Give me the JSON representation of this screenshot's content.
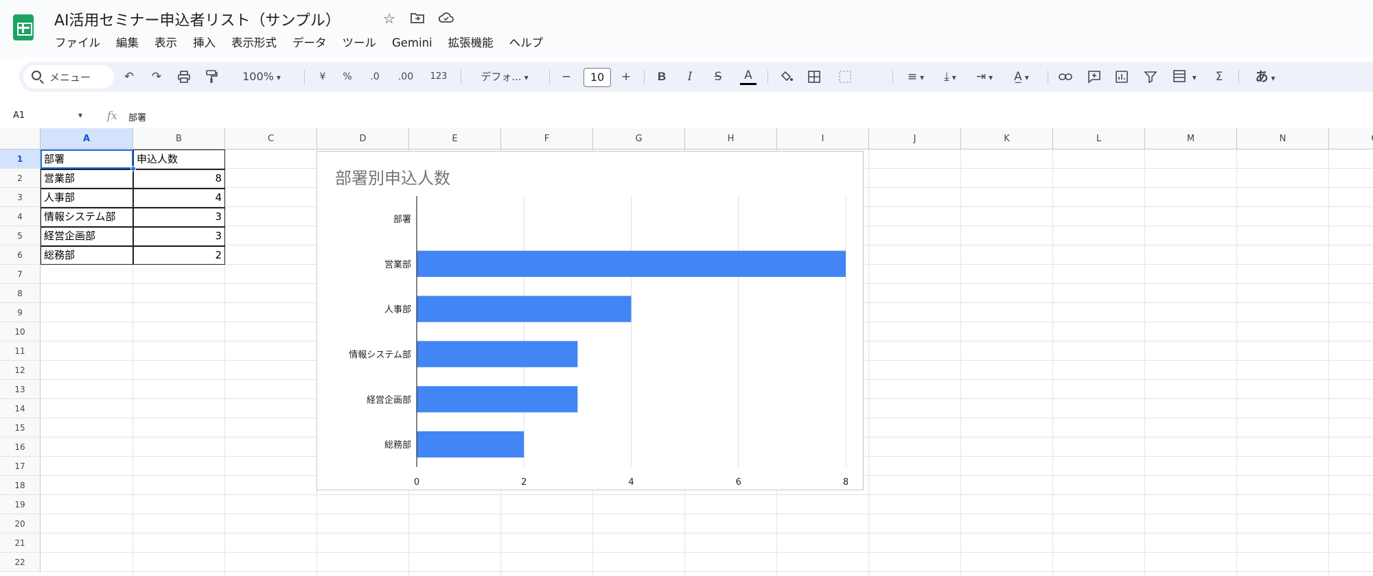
{
  "doc": {
    "title": "AI活用セミナー申込者リスト（サンプル）",
    "icons": [
      "star-icon",
      "move-folder-icon",
      "cloud-status-icon"
    ]
  },
  "menu": [
    "ファイル",
    "編集",
    "表示",
    "挿入",
    "表示形式",
    "データ",
    "ツール",
    "Gemini",
    "拡張機能",
    "ヘルプ"
  ],
  "toolbar": {
    "search_label": "メニュー",
    "zoom": "100%",
    "currency": "¥",
    "percent": "%",
    "decrease_decimal": ".0",
    "increase_decimal": ".00",
    "number_format": "123",
    "font": "デフォ...",
    "minus": "−",
    "font_size": "10",
    "plus": "+",
    "bold": "B",
    "italic": "I",
    "strike": "S",
    "text_color": "A",
    "input_tools": "あ"
  },
  "formula_bar": {
    "cell_ref": "A1",
    "fx": "fx",
    "content": "部署"
  },
  "grid": {
    "columns": [
      "A",
      "B",
      "C",
      "D",
      "E",
      "F",
      "G",
      "H",
      "I",
      "J",
      "K",
      "L",
      "M",
      "N",
      "O"
    ],
    "rows": [
      "1",
      "2",
      "3",
      "4",
      "5",
      "6",
      "7",
      "8",
      "9",
      "10",
      "11",
      "12",
      "13",
      "14",
      "15",
      "16",
      "17",
      "18",
      "19",
      "20",
      "21",
      "22"
    ],
    "selected_cell": "A1",
    "cells": [
      [
        "部署",
        "申込人数"
      ],
      [
        "営業部",
        "8"
      ],
      [
        "人事部",
        "4"
      ],
      [
        "情報システム部",
        "3"
      ],
      [
        "経営企画部",
        "3"
      ],
      [
        "総務部",
        "2"
      ]
    ]
  },
  "colors": {
    "bar": "#4285f4",
    "selection": "#1a73e8",
    "sheets_green": "#19a463"
  },
  "chart_data": {
    "type": "bar",
    "orientation": "horizontal",
    "title": "部署別申込人数",
    "categories": [
      "部署",
      "営業部",
      "人事部",
      "情報システム部",
      "経営企画部",
      "総務部"
    ],
    "values": [
      0,
      8,
      4,
      3,
      3,
      2
    ],
    "xlim": [
      0,
      8
    ],
    "xticks": [
      "0",
      "2",
      "4",
      "6",
      "8"
    ],
    "grid": true,
    "legend": "none"
  }
}
